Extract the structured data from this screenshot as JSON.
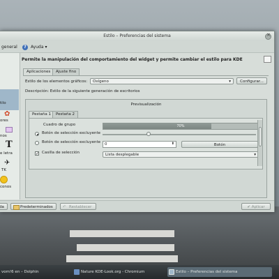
{
  "window": {
    "title": "Estilo – Preferencias del sistema"
  },
  "toolbar": {
    "overview_label": "general",
    "help_label": "Ayuda"
  },
  "sidebar": {
    "items": [
      {
        "label": "tilo",
        "selected": true
      },
      {
        "label": "ores"
      },
      {
        "label": "nos"
      },
      {
        "label": "e letra"
      },
      {
        "label": "TK"
      },
      {
        "label": "conos"
      }
    ]
  },
  "main": {
    "description": "Permite la manipulación del comportamiento del widget y permite cambiar el estilo para KDE",
    "tabs": [
      {
        "label": "Aplicaciones",
        "active": true
      },
      {
        "label": "Ajuste fino"
      }
    ],
    "style_label": "Estilo de los elementos gráficos:",
    "style_value": "Oxígeno",
    "configure_button": "Configurar...",
    "style_description": "Descripción: Estilo de la siguiente generación de escritorios"
  },
  "preview": {
    "title": "Previsualización",
    "tabs": [
      {
        "label": "Pestaña 1",
        "active": true
      },
      {
        "label": "Pestaña 2"
      }
    ],
    "groupbox_label": "Cuadro de grupo",
    "radio1_label": "Botón de selección excluyente",
    "radio2_label": "Botón de selección excluyente",
    "checkbox_label": "Casilla de selección",
    "progress_text": "70%",
    "progress_value": 0.7,
    "slider_value": 0.3,
    "spin_value": "0",
    "button_label": "Botón",
    "dropdown_label": "Lista desplegable"
  },
  "bottom": {
    "help_button": "da",
    "defaults_button": "Predeterminados",
    "reset_button": "Restablecer",
    "apply_button": "Aplicar"
  },
  "taskbar": {
    "items": [
      {
        "label": "vom!6 en – Dolphin"
      },
      {
        "label": "Nature KDE-Look.org - Chromium"
      },
      {
        "label": "Estilo – Preferencias del sistema",
        "active": true
      }
    ]
  },
  "colors": {
    "window_bg": "#d7ddd9",
    "selection": "#9fb7c9",
    "help_icon": "#3f6fb8"
  }
}
